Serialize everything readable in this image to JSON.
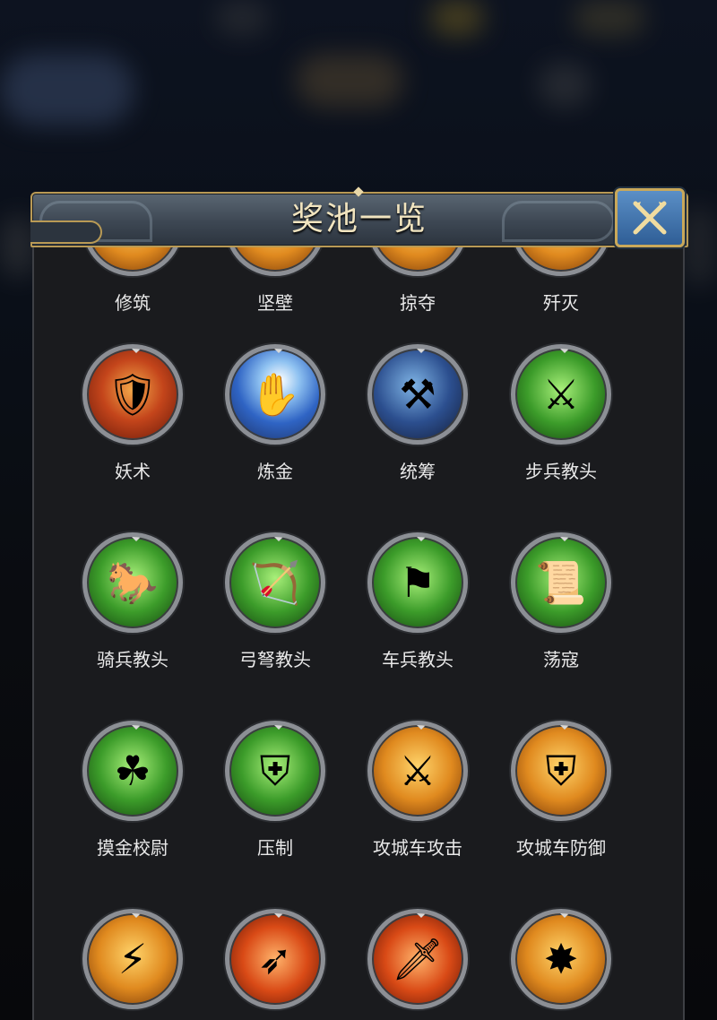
{
  "modal": {
    "title": "奖池一览",
    "close_icon": "close-x-icon"
  },
  "grid": {
    "rows": [
      [
        {
          "label": "修筑",
          "icon": "build-icon"
        },
        {
          "label": "坚壁",
          "icon": "wall-icon"
        },
        {
          "label": "掠夺",
          "icon": "plunder-icon"
        },
        {
          "label": "歼灭",
          "icon": "annihilate-icon"
        }
      ],
      [
        {
          "label": "妖术",
          "icon": "sorcery-warrior-icon",
          "bg": "red"
        },
        {
          "label": "炼金",
          "icon": "alchemy-gold-icon",
          "bg": "gold"
        },
        {
          "label": "统筹",
          "icon": "coordination-scythe-icon",
          "bg": "blue"
        },
        {
          "label": "步兵教头",
          "icon": "infantry-instructor-icon",
          "bg": "green"
        }
      ],
      [
        {
          "label": "骑兵教头",
          "icon": "cavalry-horse-icon",
          "bg": "green"
        },
        {
          "label": "弓弩教头",
          "icon": "archery-target-icon",
          "bg": "green"
        },
        {
          "label": "车兵教头",
          "icon": "chariot-banner-icon",
          "bg": "green"
        },
        {
          "label": "荡寇",
          "icon": "scroll-icon",
          "bg": "green"
        }
      ],
      [
        {
          "label": "摸金校尉",
          "icon": "gold-pendant-icon",
          "bg": "green"
        },
        {
          "label": "压制",
          "icon": "shield-wall-icon",
          "bg": "green"
        },
        {
          "label": "攻城车攻击",
          "icon": "siege-attack-icon",
          "bg": "orange"
        },
        {
          "label": "攻城车防御",
          "icon": "siege-defense-icon",
          "bg": "orange"
        }
      ],
      [
        {
          "label": "",
          "icon": "shield-lightning-icon",
          "bg": "orange"
        },
        {
          "label": "",
          "icon": "triple-darts-icon",
          "bg": "flame"
        },
        {
          "label": "",
          "icon": "beast-dagger-icon",
          "bg": "flame"
        },
        {
          "label": "",
          "icon": "rock-explosion-icon",
          "bg": "orange"
        }
      ]
    ]
  }
}
